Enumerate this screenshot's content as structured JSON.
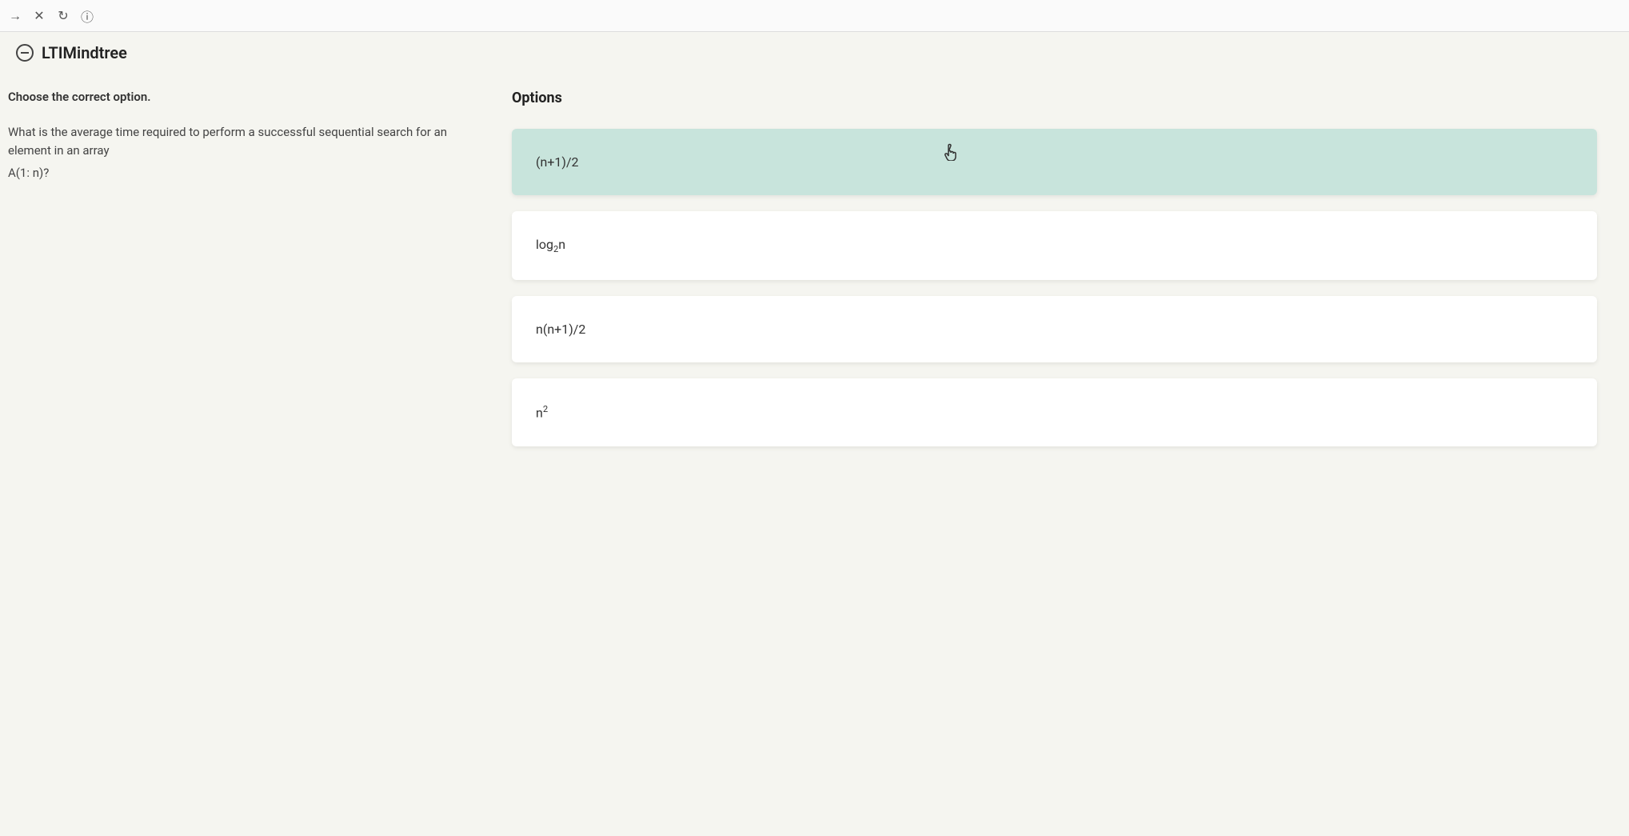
{
  "browser": {
    "close_icon": "✕",
    "refresh_icon": "↻",
    "info_icon": "ⓘ"
  },
  "header": {
    "brand": "LTIMindtree"
  },
  "question": {
    "instruction": "Choose the correct option.",
    "text": "What is the average time required to perform a successful sequential search for an element in an array",
    "sub": "A(1: n)?"
  },
  "options": {
    "title": "Options",
    "items": [
      {
        "html": "(n+1)/2",
        "selected": true
      },
      {
        "html": "log<sub>2</sub>n",
        "selected": false
      },
      {
        "html": "n(n+1)/2",
        "selected": false
      },
      {
        "html": "n<sup>2</sup>",
        "selected": false
      }
    ]
  }
}
